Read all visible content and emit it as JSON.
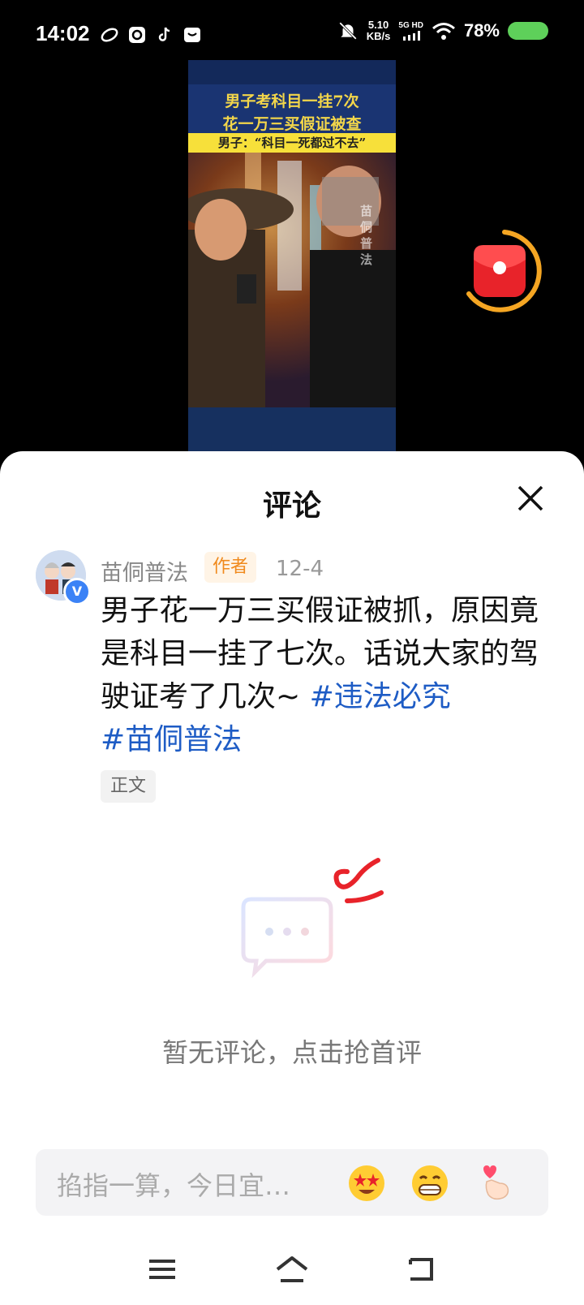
{
  "status_bar": {
    "time": "14:02",
    "net_speed_value": "5.10",
    "net_speed_unit": "KB/s",
    "network_label": "5G HD",
    "battery_percent": "78%",
    "battery_color": "#5ed05a"
  },
  "video": {
    "title_line1": "男子考科目一挂7次",
    "title_line2": "花一万三买假证被查",
    "quote": "男子：“科目一死都过不去”",
    "watermark": "苗侗普法"
  },
  "comments_sheet": {
    "title": "评论",
    "author_name": "苗侗普法",
    "author_tag": "作者",
    "verified_badge": "V",
    "post_date": "12-4",
    "post_text": "男子花一万三买假证被抓，原因竟是科目一挂了七次。话说大家的驾驶证考了几次~ ",
    "hashtag1": "#违法必究",
    "hashtag2": "#苗侗普法",
    "content_tag": "正文",
    "empty_message": "暂无评论，点击抢首评",
    "input_placeholder": "掐指一算，今日宜…"
  },
  "colors": {
    "hashtag": "#1e5cc5",
    "author_tag_bg": "#fff4e6",
    "author_tag_text": "#f08a1d"
  },
  "icons": {
    "emoji1": "star-eyes-emoji-icon",
    "emoji2": "grin-emoji-icon",
    "emoji3": "finger-heart-emoji-icon"
  }
}
